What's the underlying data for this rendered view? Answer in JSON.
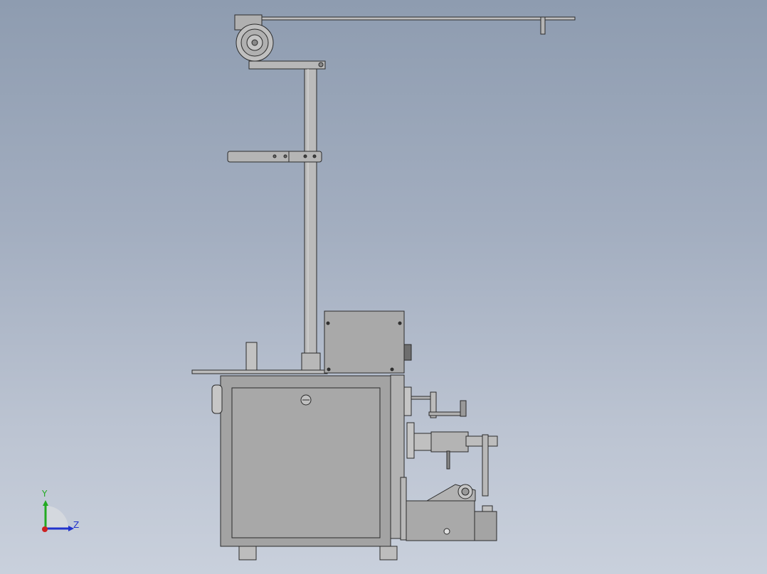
{
  "viewport": {
    "background_top": "#8e9cb0",
    "background_bottom": "#c9d0dc",
    "part_fill": "#a6a6a6",
    "part_stroke": "#2a2a2a"
  },
  "triad": {
    "y_label": "Y",
    "z_label": "Z",
    "y_color": "#22aa22",
    "z_color": "#2233cc",
    "x_color": "#cc2222",
    "icon": "coordinate-triad-icon"
  },
  "model": {
    "icon": "machine-assembly-icon"
  }
}
